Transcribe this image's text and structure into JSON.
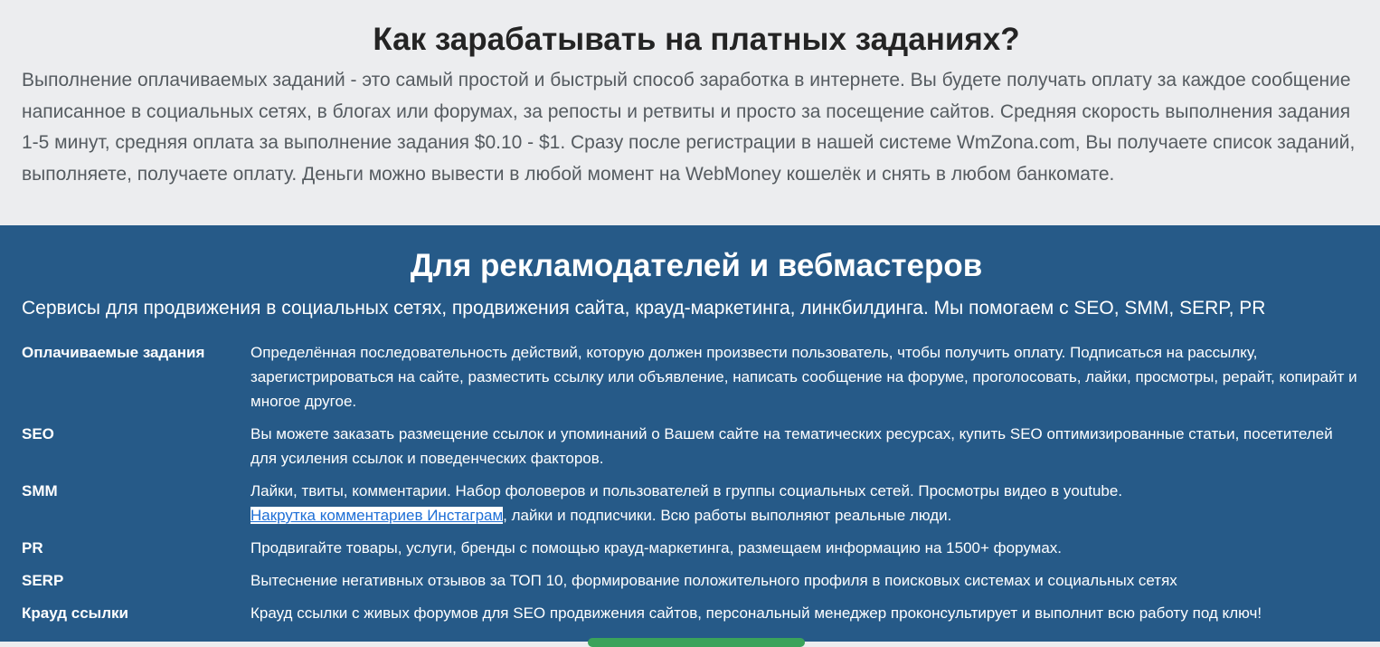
{
  "earn_section": {
    "title": "Как зарабатывать на платных заданиях?",
    "text": "Выполнение оплачиваемых заданий - это самый простой и быстрый способ заработка в интернете. Вы будете получать оплату за каждое сообщение написанное в социальных сетях, в блогах или форумах, за репосты и ретвиты и просто за посещение сайтов. Средняя скорость выполнения задания 1-5 минут, средняя оплата за выполнение задания $0.10 - $1. Сразу после регистрации в нашей системе WmZona.com, Вы получаете список заданий, выполняете, получаете оплату. Деньги можно вывести в любой момент на WebMoney кошелёк и снять в любом банкомате."
  },
  "advertisers_section": {
    "title": "Для рекламодателей и вебмастеров",
    "subtitle": "Сервисы для продвижения в социальных сетях, продвижения сайта, крауд-маркетинга, линкбилдинга. Мы помогаем с SEO, SMM, SERP, PR",
    "services": [
      {
        "term": "Оплачиваемые задания",
        "desc": "Определённая последовательность действий, которую должен произвести пользователь, чтобы получить оплату. Подписаться на рассылку, зарегистрироваться на сайте, разместить ссылку или объявление, написать сообщение на форуме, проголосовать, лайки, просмотры, рерайт, копирайт и многое другое."
      },
      {
        "term": "SEO",
        "desc": "Вы можете заказать размещение ссылок и упоминаний о Вашем сайте на тематических ресурсах, купить SEO оптимизированные статьи, посетителей для усиления ссылок и поведенческих факторов."
      },
      {
        "term": "SMM",
        "desc": "Лайки, твиты, комментарии. Набор фоловеров и пользователей в группы социальных сетей. Просмотры видео в youtube.",
        "link_text": "Накрутка комментариев Инстаграм",
        "desc_after_link": ", лайки и подписчики. Всю работы выполняют реальные люди."
      },
      {
        "term": "PR",
        "desc": "Продвигайте товары, услуги, бренды с помощью крауд-маркетинга, размещаем информацию на 1500+ форумах."
      },
      {
        "term": "SERP",
        "desc": "Вытеснение негативных отзывов за ТОП 10, формирование положительного профиля в поисковых системах и социальных сетях"
      },
      {
        "term": "Крауд ссылки",
        "desc": "Крауд ссылки с живых форумов для SEO продвижения сайтов, персональный менеджер проконсультирует и выполнит всю работу под ключ!"
      }
    ]
  },
  "colors": {
    "top_bg": "#ecedef",
    "bottom_bg": "#265a88",
    "link": "#1e6fd6"
  }
}
